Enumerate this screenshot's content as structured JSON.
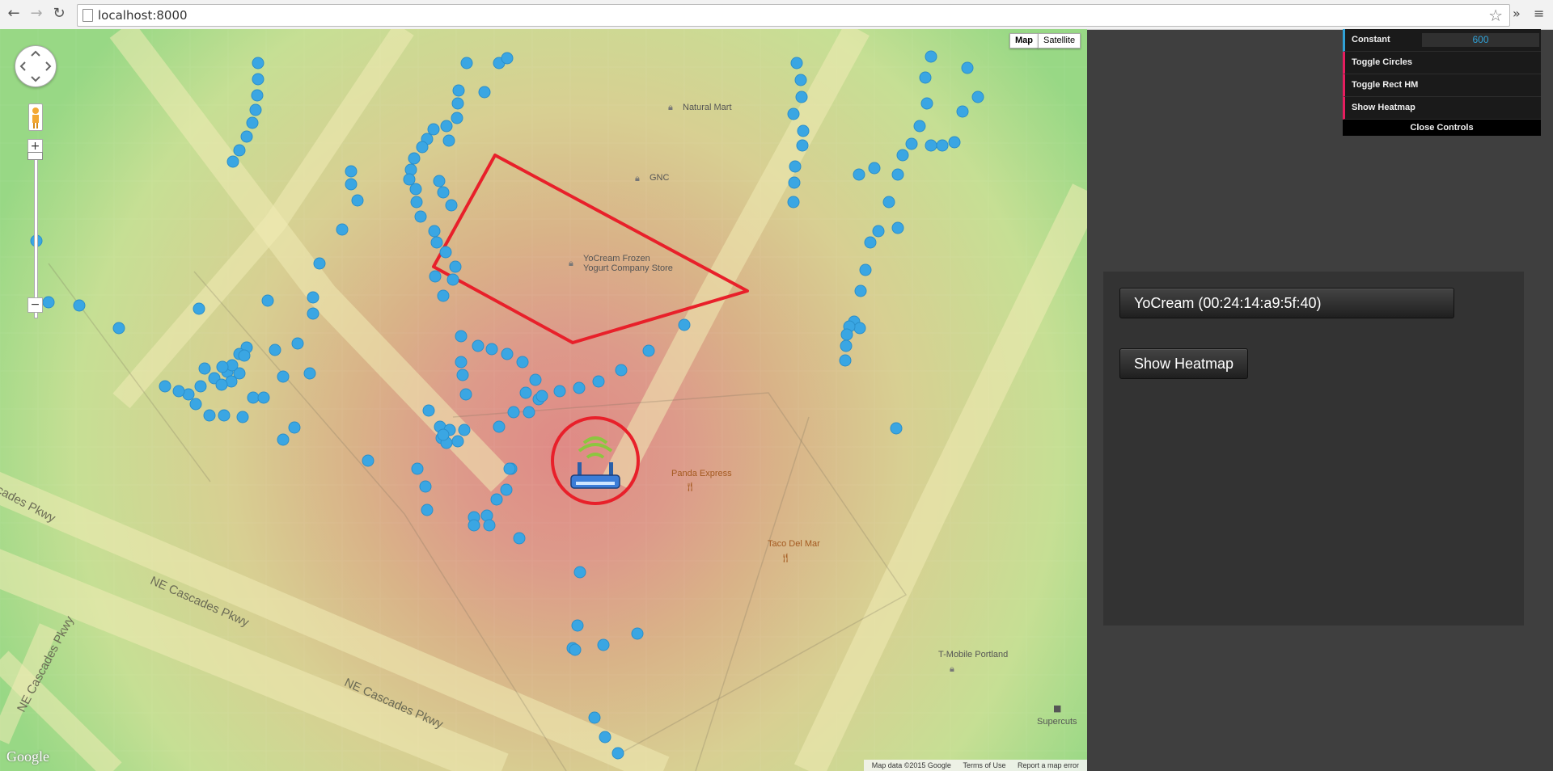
{
  "browser": {
    "url": "localhost:8000",
    "back_icon": "back-arrow-icon",
    "forward_icon": "forward-arrow-icon",
    "reload_icon": "reload-icon",
    "star_icon": "bookmark-star-icon",
    "overflow_glyph": "»",
    "menu_glyph": "≡"
  },
  "map": {
    "type_buttons": [
      "Map",
      "Satellite"
    ],
    "active_type": "Map",
    "zoom_in": "+",
    "zoom_out": "−",
    "pois": {
      "natural_mart": "Natural Mart",
      "gnc": "GNC",
      "yocream_line1": "YoCream Frozen",
      "yocream_line2": "Yogurt Company Store",
      "panda_express": "Panda Express",
      "taco_del_mar": "Taco Del Mar",
      "tmobile": "T-Mobile Portland",
      "supercuts": "Supercuts"
    },
    "roads": {
      "ne_cascades_1": "NE Cascades Pkwy",
      "ne_cascades_2": "NE Cascades Pkwy",
      "ne_cascades_3": "NE Cascades Pkwy",
      "ne_cascades_4": "scades Pkwy"
    },
    "logo": "Google",
    "footer": {
      "map_data": "Map data ©2015 Google",
      "terms": "Terms of Use",
      "report": "Report a map error"
    },
    "colors": {
      "marker": "#3aa6e3",
      "polygon": "#e8202a",
      "router_circle": "#e8202a"
    }
  },
  "controls": {
    "constant_label": "Constant",
    "constant_value": "600",
    "toggle_circles": "Toggle Circles",
    "toggle_rect_hm": "Toggle Rect HM",
    "show_heatmap": "Show Heatmap",
    "close_label": "Close Controls"
  },
  "panel": {
    "device_button": "YoCream (00:24:14:a9:5f:40)",
    "heatmap_button": "Show Heatmap"
  }
}
